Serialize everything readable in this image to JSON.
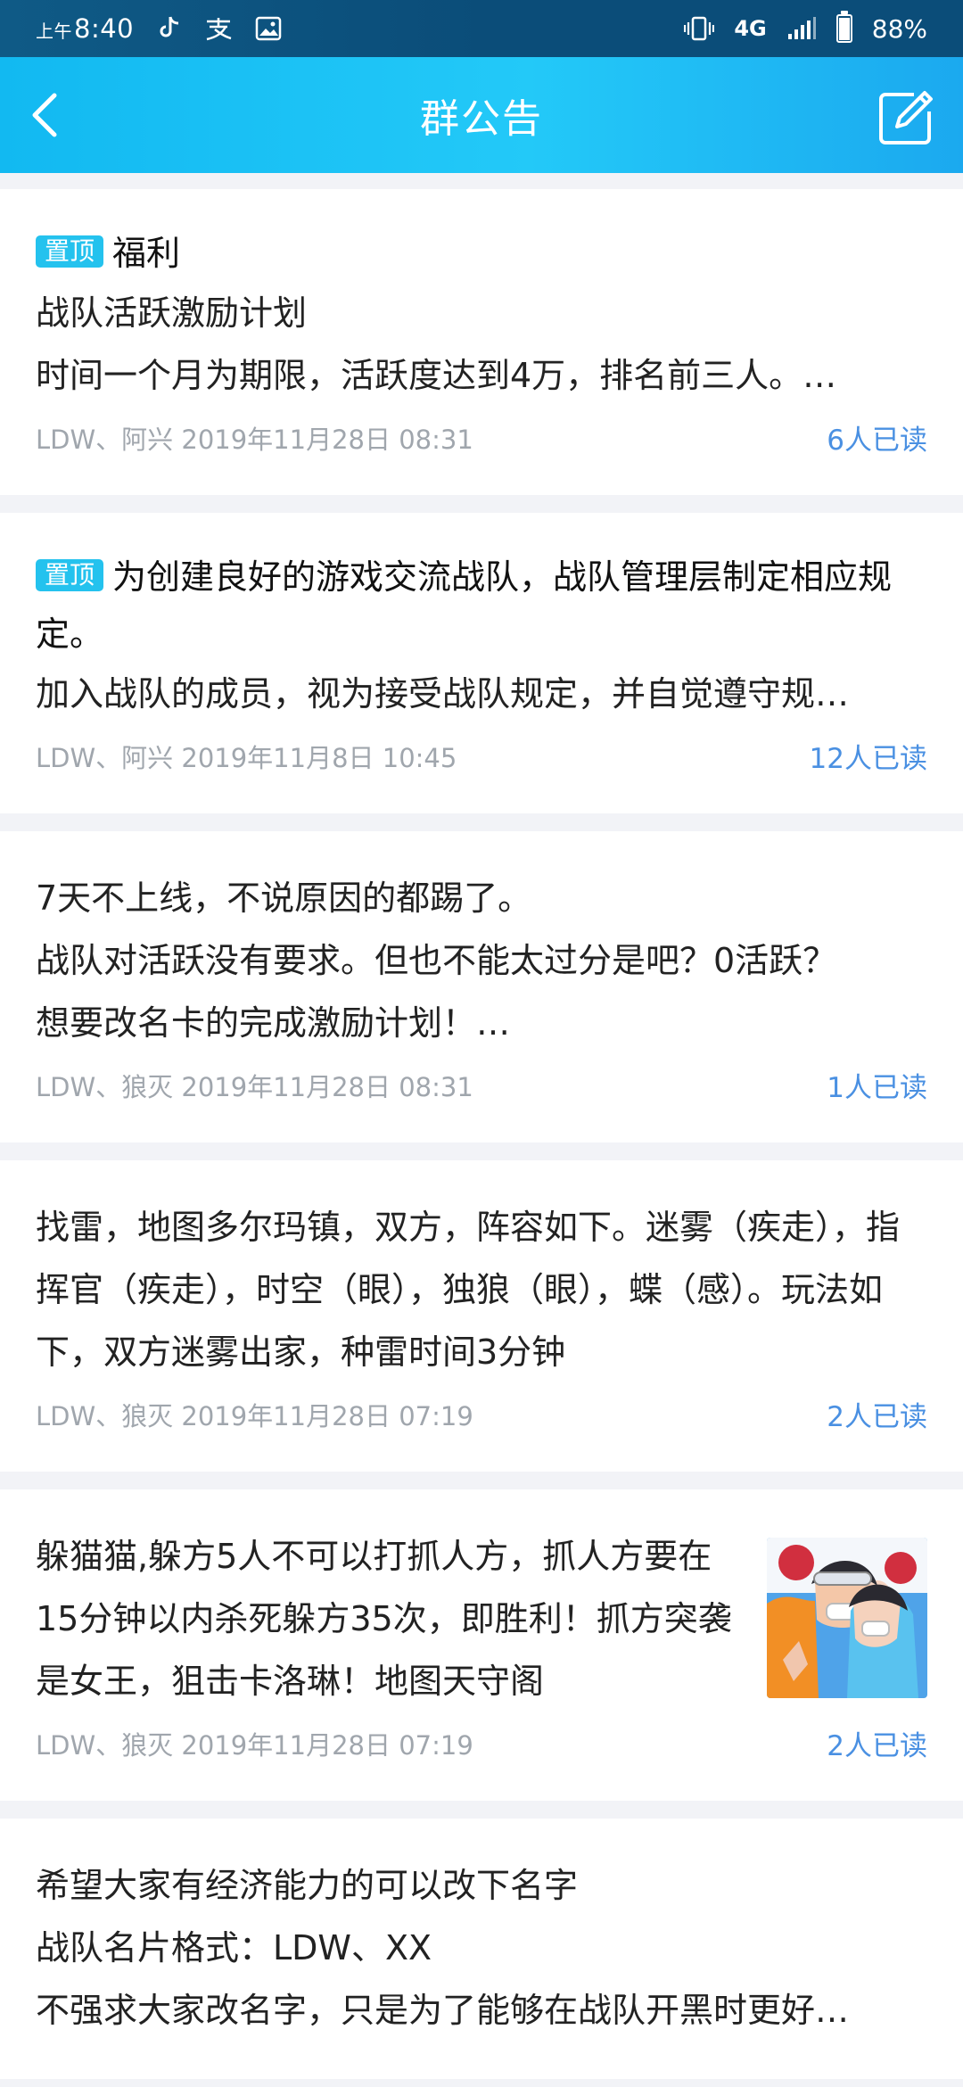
{
  "status": {
    "time_prefix": "上午",
    "time": "8:40",
    "network": "4G",
    "battery": "88%",
    "battery_level": 0.88,
    "icons": [
      "tiktok-icon",
      "alipay-icon",
      "gallery-icon",
      "vibration-icon",
      "signal-icon",
      "battery-icon"
    ]
  },
  "header": {
    "title": "群公告",
    "back_icon": "chevron-left-icon",
    "edit_icon": "edit-icon"
  },
  "announcements": [
    {
      "pin_label": "置顶",
      "title": "福利",
      "line1": "战队活跃激励计划",
      "line2": "时间一个月为期限，活跃度达到4万，排名前三人。…",
      "author_time": "LDW、阿兴 2019年11月28日 08:31",
      "read_count": "6人已读"
    },
    {
      "pin_label": "置顶",
      "title": "为创建良好的游戏交流战队，战队管理层制定相应规定。",
      "line1": "加入战队的成员，视为接受战队规定，并自觉遵守规…",
      "author_time": "LDW、阿兴 2019年11月8日 10:45",
      "read_count": "12人已读"
    },
    {
      "line1": "7天不上线，不说原因的都踢了。",
      "line2": "战队对活跃没有要求。但也不能太过分是吧？0活跃？",
      "line3": "想要改名卡的完成激励计划！…",
      "author_time": "LDW、狼灭 2019年11月28日 08:31",
      "read_count": "1人已读"
    },
    {
      "text": "找雷，地图多尔玛镇，双方，阵容如下。迷雾（疾走），指挥官（疾走），时空（眼），独狼（眼），蝶（感）。玩法如下，双方迷雾出家，种雷时间3分钟",
      "author_time": "LDW、狼灭 2019年11月28日 07:19",
      "read_count": "2人已读"
    },
    {
      "text": "躲猫猫,躲方5人不可以打抓人方，抓人方要在15分钟以内杀死躲方35次，即胜利！抓方突袭是女王，狙击卡洛琳！地图天守阁",
      "author_time": "LDW、狼灭 2019年11月28日 07:19",
      "read_count": "2人已读",
      "thumbnail": "anime-couple-image"
    },
    {
      "line1": "希望大家有经济能力的可以改下名字",
      "line2": "战队名片格式：LDW、XX",
      "line3": "不强求大家改名字，只是为了能够在战队开黑时更好…"
    }
  ],
  "colors": {
    "header_start": "#12b9f1",
    "header_end": "#1ba9ef",
    "status_bar": "#0b4d79",
    "pin_badge": "#24c2ee",
    "read_text": "#4a90e2",
    "meta_text": "#a0a6ad",
    "background": "#f2f3f7"
  }
}
